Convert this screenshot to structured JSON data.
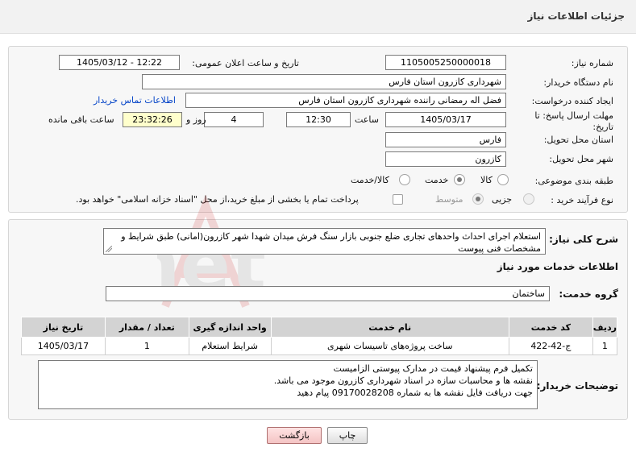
{
  "header": {
    "title": "جزئیات اطلاعات نیاز"
  },
  "fields": {
    "need_number_label": "شماره نیاز:",
    "need_number": "1105005250000018",
    "announce_label": "تاریخ و ساعت اعلان عمومی:",
    "announce_value": "1405/03/12 - 12:22",
    "buyer_org_label": "نام دستگاه خریدار:",
    "buyer_org": "شهرداری کازرون استان فارس",
    "requester_label": "ایجاد کننده درخواست:",
    "requester": "فضل اله رمضانی راننده شهرداری کازرون استان فارس",
    "contact_link": "اطلاعات تماس خریدار",
    "deadline_label": "مهلت ارسال پاسخ: تا تاریخ:",
    "deadline_date": "1405/03/17",
    "time_label": "ساعت",
    "deadline_time": "12:30",
    "days_value": "4",
    "days_label": "روز و",
    "remaining_time": "23:32:26",
    "remaining_label": "ساعت باقی مانده",
    "province_label": "استان محل تحویل:",
    "province": "فارس",
    "city_label": "شهر محل تحویل:",
    "city": "کازرون",
    "category_label": "طبقه بندی موضوعی:",
    "category_options": [
      "کالا",
      "خدمت",
      "کالا/خدمت"
    ],
    "category_selected": "خدمت",
    "process_label": "نوع فرآیند خرید :",
    "process_options": [
      "جزیی",
      "متوسط"
    ],
    "process_selected": "جزیی",
    "payment_note": "پرداخت تمام یا بخشی از مبلغ خرید،از محل \"اسناد خزانه اسلامی\" خواهد بود."
  },
  "description": {
    "label": "شرح کلی نیاز:",
    "text": "استعلام اجرای احداث واحدهای تجاری ضلع جنوبی بازار سنگ فرش میدان شهدا شهر کازرون(امانی) طبق شرایط و مشخصات فنی پیوست"
  },
  "services": {
    "section_title": "اطلاعات خدمات مورد نیاز",
    "group_label": "گروه خدمت:",
    "group_value": "ساختمان",
    "table_headers": [
      "ردیف",
      "کد خدمت",
      "نام خدمت",
      "واحد اندازه گیری",
      "تعداد / مقدار",
      "تاریخ نیاز"
    ],
    "rows": [
      {
        "row": "1",
        "code": "ج-42-422",
        "name": "ساخت پروژه‌های تاسیسات شهری",
        "unit": "شرایط استعلام",
        "qty": "1",
        "date": "1405/03/17"
      }
    ]
  },
  "buyer_notes": {
    "label": "توضیحات خریدار:",
    "line1": "تکمیل فرم پیشنهاد قیمت در مدارک پیوستی الزامیست",
    "line2": "نقشه ها و محاسبات سازه در اسناد شهرداری کازرون موجود می باشد.",
    "line3": "جهت دریافت فایل نقشه ها به شماره 09170028208 پیام دهید"
  },
  "buttons": {
    "print": "چاپ",
    "back": "بازگشت"
  },
  "watermark": {
    "text": "AriaTender.net"
  },
  "colors": {
    "link": "#0645c8",
    "highlight": "#ffffcc",
    "table_header": "#d3d3d3",
    "watermark": "#cc3333"
  }
}
